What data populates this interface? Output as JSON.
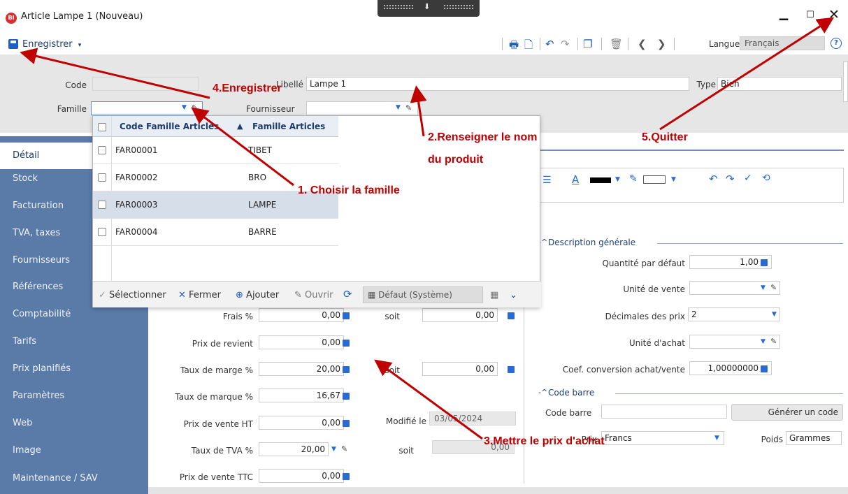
{
  "window": {
    "title": "Article Lampe 1 (Nouveau)",
    "app_badge": "BI"
  },
  "toolbar": {
    "save_label": "Enregistrer",
    "save_dropdown": "▾",
    "language_label": "Langue",
    "language_value": "Français"
  },
  "header": {
    "code_label": "Code",
    "code_value": "",
    "libelle_label": "Libellé",
    "libelle_value": "Lampe 1",
    "type_label": "Type",
    "type_value": "Bien",
    "famille_label": "Famille",
    "famille_value": "",
    "fournisseur_label": "Fournisseur",
    "fournisseur_value": ""
  },
  "sidebar": {
    "items": [
      {
        "label": "Détail"
      },
      {
        "label": "Stock"
      },
      {
        "label": "Facturation"
      },
      {
        "label": "TVA, taxes"
      },
      {
        "label": "Fournisseurs"
      },
      {
        "label": "Références"
      },
      {
        "label": "Comptabilité"
      },
      {
        "label": "Tarifs"
      },
      {
        "label": "Prix planifiés"
      },
      {
        "label": "Paramètres"
      },
      {
        "label": "Web"
      },
      {
        "label": "Image"
      },
      {
        "label": "Maintenance / SAV"
      }
    ]
  },
  "popup": {
    "col_code": "Code Famille Articles",
    "col_famille": "Famille Articles",
    "sort_icon": "▲",
    "rows": [
      {
        "code": "FAR00001",
        "famille": "TIBET"
      },
      {
        "code": "FAR00002",
        "famille": "BRO"
      },
      {
        "code": "FAR00003",
        "famille": "LAMPE"
      },
      {
        "code": "FAR00004",
        "famille": "BARRE"
      }
    ],
    "footer": {
      "select": "Sélectionner",
      "close": "Fermer",
      "add": "Ajouter",
      "open": "Ouvrir",
      "view": "Défaut (Système)"
    }
  },
  "pricing": {
    "frais_label": "Frais %",
    "frais_value": "0,00",
    "frais_soit_label": "soit",
    "frais_soit_value": "0,00",
    "revient_label": "Prix de revient",
    "revient_value": "0,00",
    "marge_label": "Taux de marge %",
    "marge_value": "20,00",
    "marge_soit_label": "soit",
    "marge_soit_value": "0,00",
    "marque_label": "Taux de marque %",
    "marque_value": "16,67",
    "pvht_label": "Prix de vente HT",
    "pvht_value": "0,00",
    "modifie_label": "Modifié le",
    "modifie_value": "03/05/2024",
    "tva_label": "Taux de TVA %",
    "tva_value": "20,00",
    "tva_soit_label": "soit",
    "tva_soit_value": "0,00",
    "pvttc_label": "Prix de vente TTC",
    "pvttc_value": "0,00"
  },
  "description": {
    "title": "Description générale",
    "qte_label": "Quantité par défaut",
    "qte_value": "1,00",
    "unite_vente_label": "Unité de vente",
    "unite_vente_value": "",
    "decimales_label": "Décimales des prix",
    "decimales_value": "2",
    "unite_achat_label": "Unité d'achat",
    "unite_achat_value": "",
    "coef_label": "Coef. conversion achat/vente",
    "coef_value": "1,00000000"
  },
  "barcode": {
    "title": "Code barre",
    "code_label": "Code barre",
    "code_value": "",
    "generate_button": "Générer un code",
    "prix_label": "Prix",
    "prix_value": "Francs",
    "poids_label": "Poids",
    "poids_value": "Grammes"
  },
  "annotations": {
    "a1": "1. Choisir la famille",
    "a2_line1": "2.Renseigner le nom",
    "a2_line2": "du produit",
    "a3": "3.Mettre le prix d'achat",
    "a4": "4.Enregistrer",
    "a5": "5.Quitter",
    "color": "#c00000"
  }
}
